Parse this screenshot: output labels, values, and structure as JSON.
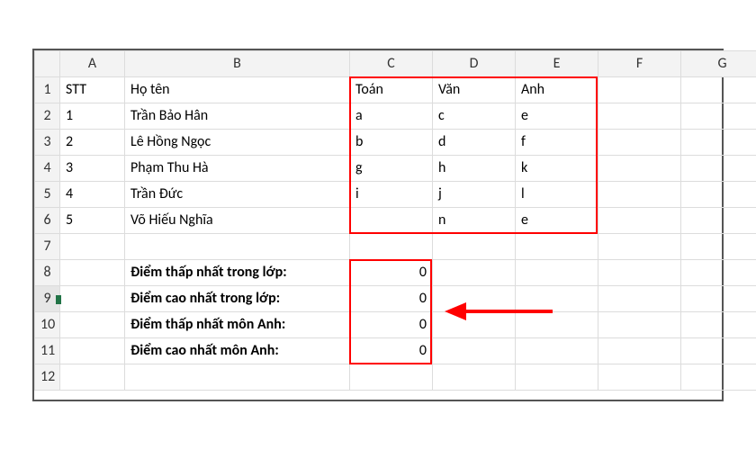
{
  "columns": [
    "A",
    "B",
    "C",
    "D",
    "E",
    "F",
    "G"
  ],
  "row_numbers": [
    1,
    2,
    3,
    4,
    5,
    6,
    7,
    8,
    9,
    10,
    11,
    12
  ],
  "headers": {
    "stt": "STT",
    "name": "Họ tên",
    "c": "Toán",
    "d": "Văn",
    "e": "Anh"
  },
  "students": [
    {
      "stt": 1,
      "name": "Trần Bảo Hân",
      "c": "a",
      "d": "c",
      "e": "e"
    },
    {
      "stt": 2,
      "name": "Lê Hồng Ngọc",
      "c": "b",
      "d": "d",
      "e": "f"
    },
    {
      "stt": 3,
      "name": "Phạm Thu Hà",
      "c": "g",
      "d": "h",
      "e": "k"
    },
    {
      "stt": 4,
      "name": "Trần Đức",
      "c": "i",
      "d": "j",
      "e": "l"
    },
    {
      "stt": 5,
      "name": "Võ Hiếu Nghĩa",
      "c": "",
      "d": "n",
      "e": "e"
    }
  ],
  "summary": [
    {
      "label": "Điểm thấp nhất trong lớp:",
      "value": 0
    },
    {
      "label": "Điểm cao nhất trong lớp:",
      "value": 0
    },
    {
      "label": "Điểm thấp nhất môn Anh:",
      "value": 0
    },
    {
      "label": "Điểm cao nhất môn Anh:",
      "value": 0
    }
  ],
  "chart_data": {
    "type": "table",
    "title": "",
    "columns": [
      "STT",
      "Họ tên",
      "Toán",
      "Văn",
      "Anh"
    ],
    "rows": [
      [
        1,
        "Trần Bảo Hân",
        "a",
        "c",
        "e"
      ],
      [
        2,
        "Lê Hồng Ngọc",
        "b",
        "d",
        "f"
      ],
      [
        3,
        "Phạm Thu Hà",
        "g",
        "h",
        "k"
      ],
      [
        4,
        "Trần Đức",
        "i",
        "j",
        "l"
      ],
      [
        5,
        "Võ Hiếu Nghĩa",
        "",
        "n",
        "e"
      ]
    ],
    "summary": {
      "Điểm thấp nhất trong lớp:": 0,
      "Điểm cao nhất trong lớp:": 0,
      "Điểm thấp nhất môn Anh:": 0,
      "Điểm cao nhất môn Anh:": 0
    }
  }
}
